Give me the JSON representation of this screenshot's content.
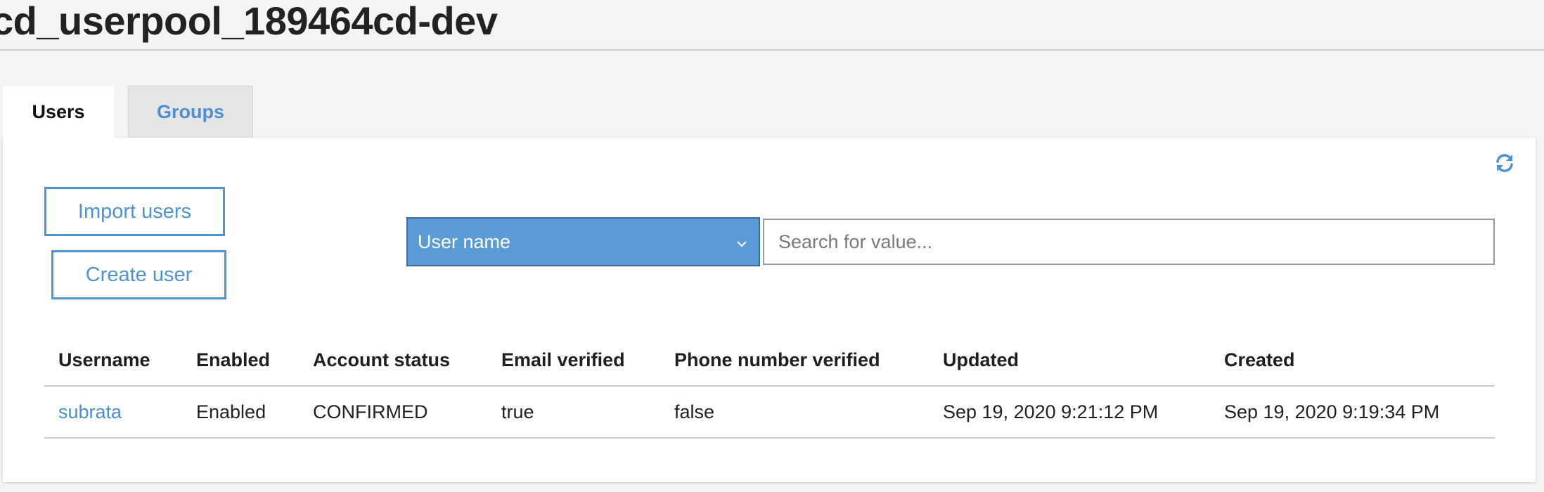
{
  "header": {
    "title": "cd_userpool_189464cd-dev"
  },
  "tabs": [
    {
      "label": "Users",
      "active": true
    },
    {
      "label": "Groups",
      "active": false
    }
  ],
  "toolbar": {
    "import_label": "Import users",
    "create_label": "Create user",
    "refresh_icon": "refresh-icon"
  },
  "search": {
    "attribute_selected": "User name",
    "placeholder": "Search for value...",
    "value": ""
  },
  "table": {
    "columns": [
      "Username",
      "Enabled",
      "Account status",
      "Email verified",
      "Phone number verified",
      "Updated",
      "Created"
    ],
    "rows": [
      {
        "username": "subrata",
        "enabled": "Enabled",
        "account_status": "CONFIRMED",
        "email_verified": "true",
        "phone_verified": "false",
        "updated": "Sep 19, 2020 9:21:12 PM",
        "created": "Sep 19, 2020 9:19:34 PM"
      }
    ]
  },
  "colors": {
    "accent": "#4f93d3",
    "select_bg": "#5b9bd5",
    "page_bg": "#f3f4f3"
  }
}
